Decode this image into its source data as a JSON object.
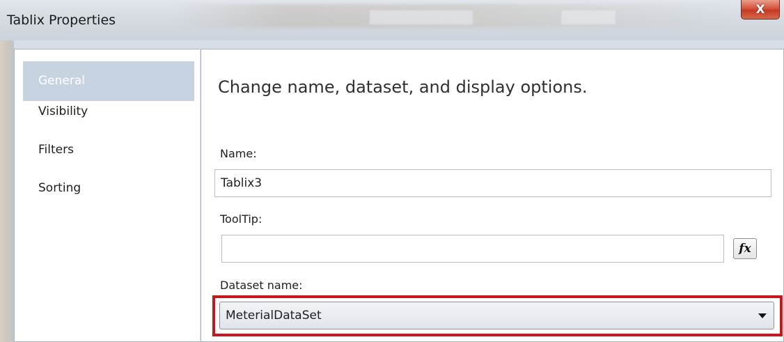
{
  "window": {
    "title": "Tablix Properties",
    "close_glyph": "X"
  },
  "nav": {
    "items": [
      {
        "label": "General",
        "selected": true
      },
      {
        "label": "Visibility",
        "selected": false
      },
      {
        "label": "Filters",
        "selected": false
      },
      {
        "label": "Sorting",
        "selected": false
      }
    ]
  },
  "main": {
    "heading": "Change name, dataset, and display options.",
    "name_label": "Name:",
    "name_value": "Tablix3",
    "tooltip_label": "ToolTip:",
    "tooltip_value": "",
    "fx_label": "fx",
    "dataset_label": "Dataset name:",
    "dataset_value": "MeterialDataSet"
  },
  "colors": {
    "selected_nav_bg": "#c7d3e1",
    "highlight_border": "#c8161d",
    "close_button": "#d7523a"
  },
  "icons": {
    "close": "close-icon",
    "dropdown": "chevron-down-icon",
    "expression": "fx-icon"
  }
}
